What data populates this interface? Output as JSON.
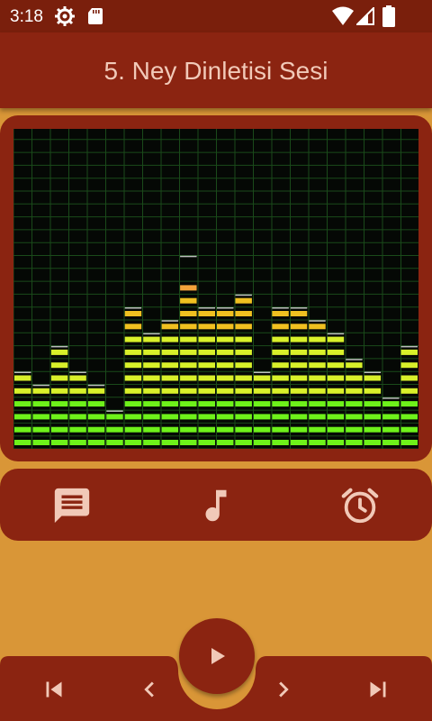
{
  "status_bar": {
    "time": "3:18",
    "icons": [
      "settings-gear-icon",
      "sd-card-icon",
      "wifi-icon",
      "signal-icon",
      "battery-icon"
    ]
  },
  "header": {
    "title": "5. Ney Dinletisi Sesi"
  },
  "visualizer": {
    "grid_color": "#1a4a1a",
    "peak_color": "#f2a23a",
    "bar_color_low": "#6ef21a",
    "bar_color_mid": "#d8f02a",
    "bar_color_high": "#f0c020",
    "max_segments": 25,
    "levels": [
      6,
      5,
      8,
      6,
      5,
      3,
      11,
      9,
      10,
      13,
      11,
      11,
      12,
      6,
      11,
      11,
      10,
      9,
      7,
      6,
      4,
      8
    ],
    "peaks": [
      6,
      5,
      8,
      6,
      5,
      3,
      11,
      9,
      10,
      15,
      11,
      11,
      12,
      6,
      11,
      11,
      10,
      9,
      7,
      6,
      4,
      8
    ]
  },
  "tools": [
    {
      "name": "comments-button",
      "icon": "chat-message-icon"
    },
    {
      "name": "music-button",
      "icon": "music-note-icon"
    },
    {
      "name": "alarm-button",
      "icon": "alarm-clock-icon"
    }
  ],
  "colors": {
    "background": "#d99637",
    "primary_dark": "#7a1f0c",
    "primary": "#8b2411",
    "title_text": "#f1c9b8",
    "icon_light": "#f1c9b8"
  },
  "navigation": {
    "icons": [
      "skip-previous-icon",
      "chevron-left-icon",
      "play-icon",
      "chevron-right-icon",
      "skip-next-icon"
    ]
  }
}
